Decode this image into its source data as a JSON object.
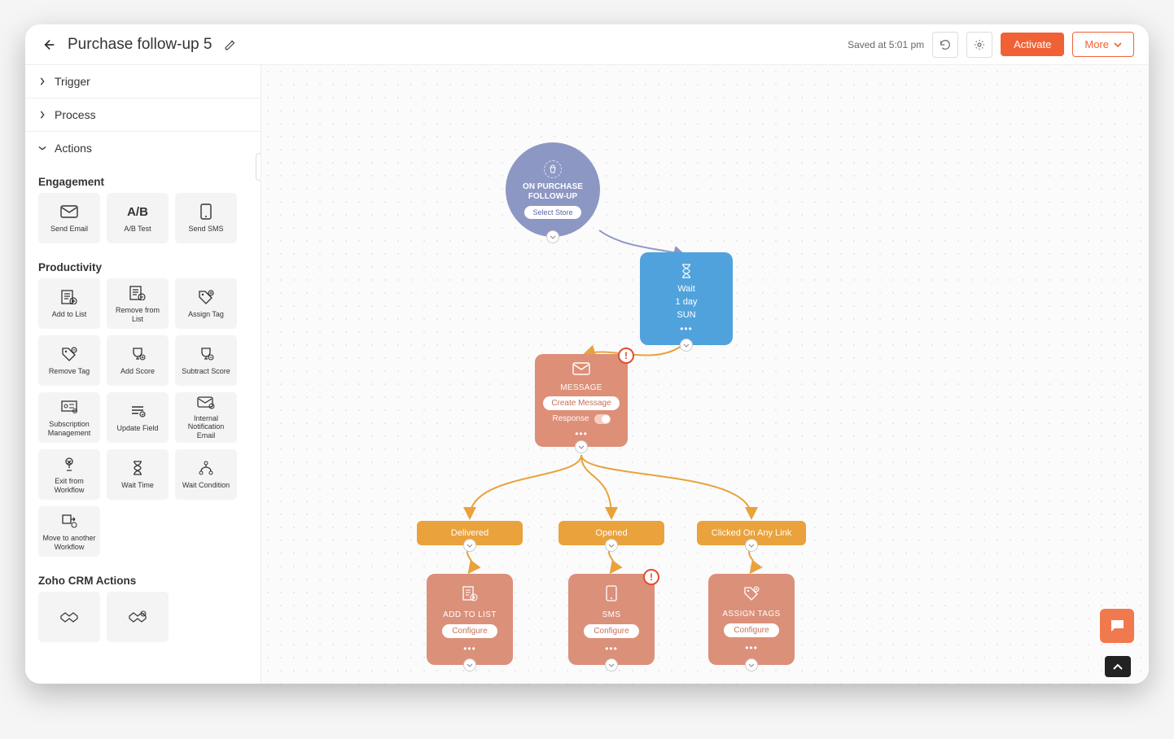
{
  "header": {
    "title": "Purchase follow-up 5",
    "saved": "Saved at 5:01 pm",
    "activate": "Activate",
    "more": "More"
  },
  "sidebar": {
    "sections": {
      "trigger": "Trigger",
      "process": "Process",
      "actions": "Actions"
    },
    "groups": {
      "engagement": {
        "title": "Engagement",
        "tiles": [
          {
            "label": "Send Email",
            "icon": "mail-icon"
          },
          {
            "label": "A/B Test",
            "icon": "ab-icon"
          },
          {
            "label": "Send SMS",
            "icon": "phone-sms-icon"
          }
        ]
      },
      "productivity": {
        "title": "Productivity",
        "tiles": [
          {
            "label": "Add to List",
            "icon": "list-add-icon"
          },
          {
            "label": "Remove from List",
            "icon": "list-remove-icon"
          },
          {
            "label": "Assign Tag",
            "icon": "tag-add-icon"
          },
          {
            "label": "Remove Tag",
            "icon": "tag-remove-icon"
          },
          {
            "label": "Add Score",
            "icon": "trophy-add-icon"
          },
          {
            "label": "Subtract Score",
            "icon": "trophy-minus-icon"
          },
          {
            "label": "Subscription Management",
            "icon": "subscription-icon"
          },
          {
            "label": "Update Field",
            "icon": "update-field-icon"
          },
          {
            "label": "Internal Notification Email",
            "icon": "mail-check-icon"
          },
          {
            "label": "Exit from Workflow",
            "icon": "exit-icon"
          },
          {
            "label": "Wait Time",
            "icon": "hourglass-icon"
          },
          {
            "label": "Wait Condition",
            "icon": "fork-icon"
          },
          {
            "label": "Move to another Workflow",
            "icon": "move-workflow-icon"
          }
        ]
      },
      "crm": {
        "title": "Zoho CRM Actions",
        "tiles": [
          {
            "label": "",
            "icon": "handshake-icon"
          },
          {
            "label": "",
            "icon": "handshake-check-icon"
          }
        ]
      }
    }
  },
  "canvas": {
    "trigger": {
      "title": "ON PURCHASE FOLLOW-UP",
      "pill": "Select Store"
    },
    "wait": {
      "title": "Wait",
      "duration": "1 day",
      "day": "SUN"
    },
    "message": {
      "title": "MESSAGE",
      "pill": "Create Message",
      "response": "Response"
    },
    "branches": {
      "delivered": "Delivered",
      "opened": "Opened",
      "clicked": "Clicked On Any Link"
    },
    "actions": {
      "addlist": {
        "title": "ADD TO LIST",
        "pill": "Configure"
      },
      "sms": {
        "title": "SMS",
        "pill": "Configure"
      },
      "tags": {
        "title": "ASSIGN TAGS",
        "pill": "Configure"
      }
    }
  },
  "colors": {
    "accent": "#f06236",
    "wait": "#50a2dc",
    "trigger": "#8d97c4",
    "branch": "#e9a23c",
    "action": "#dd8f77"
  }
}
